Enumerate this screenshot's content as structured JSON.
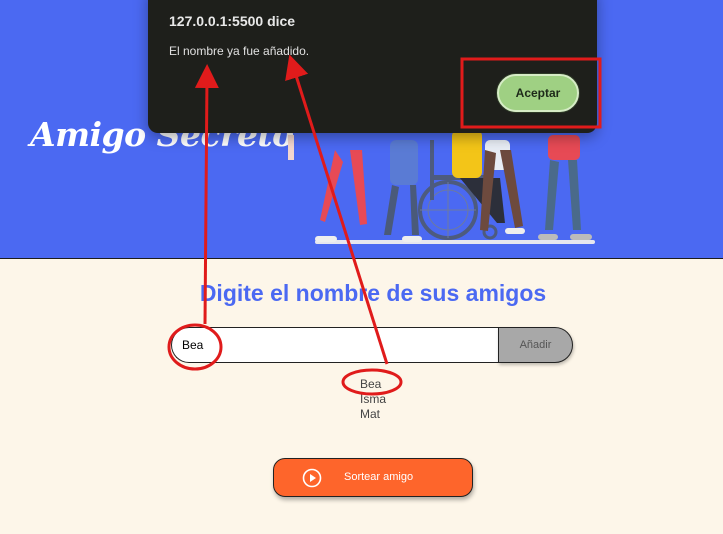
{
  "app": {
    "title": "Amigo Secreto"
  },
  "main": {
    "subtitle": "Digite el nombre de sus amigos",
    "name_input_value": "Bea",
    "add_label": "Añadir",
    "friends": [
      "Bea",
      "Isma",
      "Mat"
    ],
    "draw_label": "Sortear amigo"
  },
  "dialog": {
    "origin": "127.0.0.1:5500 dice",
    "message": "El nombre ya fue añadido.",
    "accept_label": "Aceptar"
  },
  "colors": {
    "header_bg": "#4b69f2",
    "page_bg": "#fdf6e9",
    "accent_orange": "#fe652b",
    "accept_green": "#9fd083",
    "annotation_red": "#e01b1b"
  },
  "icons": {
    "draw_button_icon": "play-circle-icon"
  }
}
